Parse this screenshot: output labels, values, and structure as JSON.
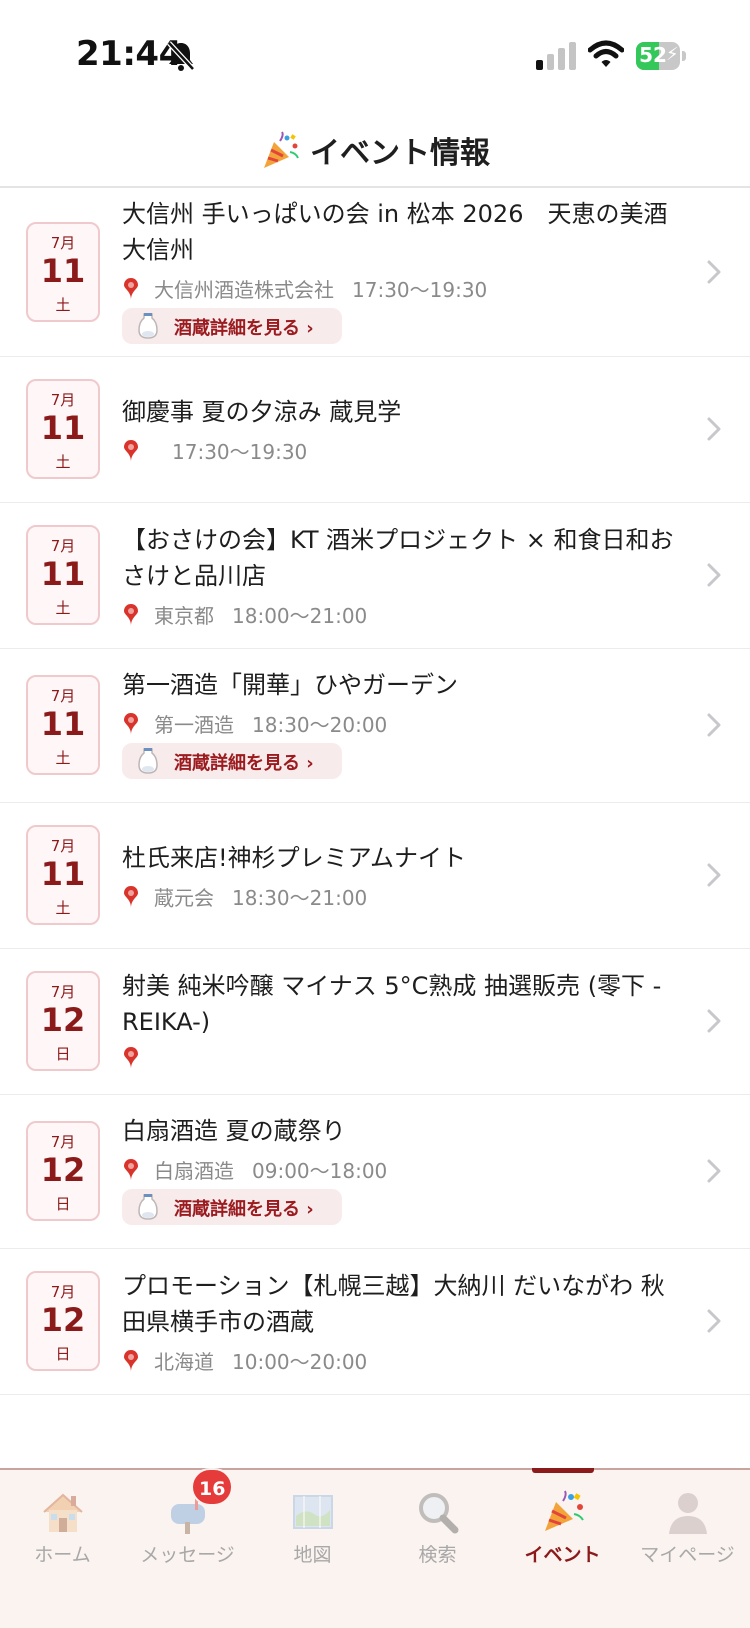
{
  "status_bar": {
    "time": "21:44",
    "battery": "52",
    "battery_level": 0.52
  },
  "header": {
    "title": "イベント情報",
    "icon": "party-popper-icon"
  },
  "events": [
    {
      "month": "7月",
      "day": "11",
      "dow": "土",
      "title": "大信州 手いっぱいの会 in 松本 2026　天恵の美酒 大信州",
      "venue": "大信州酒造株式会社",
      "time": "17:30～19:30",
      "brewery_button": "酒蔵詳細を見る ›"
    },
    {
      "month": "7月",
      "day": "11",
      "dow": "土",
      "title": "御慶事 夏の夕涼み 蔵見学",
      "venue": "",
      "time": "17:30～19:30",
      "brewery_button": null
    },
    {
      "month": "7月",
      "day": "11",
      "dow": "土",
      "title": "【おさけの会】KT 酒米プロジェクト × 和食日和おさけと品川店",
      "venue": "東京都",
      "time": "18:00～21:00",
      "brewery_button": null
    },
    {
      "month": "7月",
      "day": "11",
      "dow": "土",
      "title": "第一酒造「開華」ひやガーデン",
      "venue": "第一酒造",
      "time": "18:30～20:00",
      "brewery_button": "酒蔵詳細を見る ›"
    },
    {
      "month": "7月",
      "day": "11",
      "dow": "土",
      "title": "杜氏来店!神杉プレミアムナイト",
      "venue": "蔵元会",
      "time": "18:30～21:00",
      "brewery_button": null
    },
    {
      "month": "7月",
      "day": "12",
      "dow": "日",
      "title": "射美 純米吟醸 マイナス 5°C熟成 抽選販売 (零下 -REIKA-)",
      "venue": "",
      "time": "",
      "brewery_button": null
    },
    {
      "month": "7月",
      "day": "12",
      "dow": "日",
      "title": "白扇酒造 夏の蔵祭り",
      "venue": "白扇酒造",
      "time": "09:00～18:00",
      "brewery_button": "酒蔵詳細を見る ›"
    },
    {
      "month": "7月",
      "day": "12",
      "dow": "日",
      "title": "プロモーション【札幌三越】大納川 だいながわ 秋田県横手市の酒蔵",
      "venue": "北海道",
      "time": "10:00～20:00",
      "brewery_button": null
    }
  ],
  "tab_bar": {
    "tabs": [
      {
        "label": "ホーム",
        "icon": "house-icon"
      },
      {
        "label": "メッセージ",
        "icon": "mailbox-icon",
        "badge": "16"
      },
      {
        "label": "地図",
        "icon": "map-icon"
      },
      {
        "label": "検索",
        "icon": "magnifier-icon"
      },
      {
        "label": "イベント",
        "icon": "party-popper-icon",
        "active": true
      },
      {
        "label": "マイページ",
        "icon": "user-icon"
      }
    ]
  },
  "colors": {
    "accent": "#8b1a1a",
    "badge": "#e63b3b",
    "battery_green": "#34c759",
    "tabbar_bg": "#fbf3f0"
  }
}
